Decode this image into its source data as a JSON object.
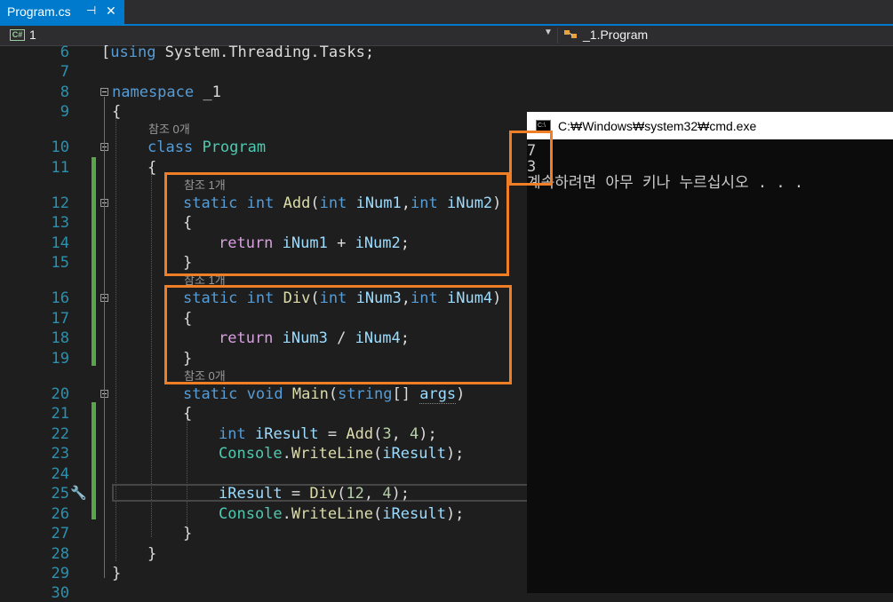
{
  "tab": {
    "title": "Program.cs",
    "pin": "⊣",
    "close": "✕"
  },
  "navbar": {
    "project_badge": "C#",
    "project": "1",
    "class": "_1.Program"
  },
  "code_lens": {
    "l10": "참조 0개",
    "l12": "참조 1개",
    "l16": "참조 1개",
    "l20": "참조 0개"
  },
  "lines": [
    {
      "n": "6"
    },
    {
      "n": "7"
    },
    {
      "n": "8"
    },
    {
      "n": "9"
    },
    {
      "n": "10"
    },
    {
      "n": "11"
    },
    {
      "n": "12"
    },
    {
      "n": "13"
    },
    {
      "n": "14"
    },
    {
      "n": "15"
    },
    {
      "n": "16"
    },
    {
      "n": "17"
    },
    {
      "n": "18"
    },
    {
      "n": "19"
    },
    {
      "n": "20"
    },
    {
      "n": "21"
    },
    {
      "n": "22"
    },
    {
      "n": "23"
    },
    {
      "n": "24"
    },
    {
      "n": "25"
    },
    {
      "n": "26"
    },
    {
      "n": "27"
    },
    {
      "n": "28"
    },
    {
      "n": "29"
    },
    {
      "n": "30"
    }
  ],
  "code": {
    "l6": [
      "using",
      " System.Threading.Tasks;"
    ],
    "l8": [
      "namespace",
      " _1"
    ],
    "l9": "{",
    "l10": [
      "class",
      " ",
      "Program"
    ],
    "l11": "{",
    "l12": [
      "static",
      " ",
      "int",
      " ",
      "Add",
      "(",
      "int",
      " ",
      "iNum1",
      ",",
      "int",
      " ",
      "iNum2",
      ")"
    ],
    "l13": "{",
    "l14": [
      "return",
      " ",
      "iNum1",
      " + ",
      "iNum2",
      ";"
    ],
    "l15": "}",
    "l16": [
      "static",
      " ",
      "int",
      " ",
      "Div",
      "(",
      "int",
      " ",
      "iNum3",
      ",",
      "int",
      " ",
      "iNum4",
      ")"
    ],
    "l17": "{",
    "l18": [
      "return",
      " ",
      "iNum3",
      " / ",
      "iNum4",
      ";"
    ],
    "l19": "}",
    "l20": [
      "static",
      " ",
      "void",
      " ",
      "Main",
      "(",
      "string",
      "[] ",
      "args",
      ")"
    ],
    "l21": "{",
    "l22": [
      "int",
      " ",
      "iResult",
      " = ",
      "Add",
      "(",
      "3",
      ", ",
      "4",
      ");"
    ],
    "l23": [
      "Console",
      ".",
      "WriteLine",
      "(",
      "iResult",
      ");"
    ],
    "l25": [
      "iResult",
      " = ",
      "Div",
      "(",
      "12",
      ", ",
      "4",
      ");"
    ],
    "l26": [
      "Console",
      ".",
      "WriteLine",
      "(",
      "iResult",
      ");"
    ],
    "l27": "}",
    "l28": "}",
    "l29": "}"
  },
  "console": {
    "title": "C:₩Windows₩system32₩cmd.exe",
    "icon_text": "C:\\",
    "out1": "7",
    "out2": "3",
    "out3": "계속하려면 아무 키나 누르십시오 . . ."
  },
  "colors": {
    "accent": "#007acc",
    "highlight": "#f07e26",
    "change_bar": "#57a64a"
  }
}
